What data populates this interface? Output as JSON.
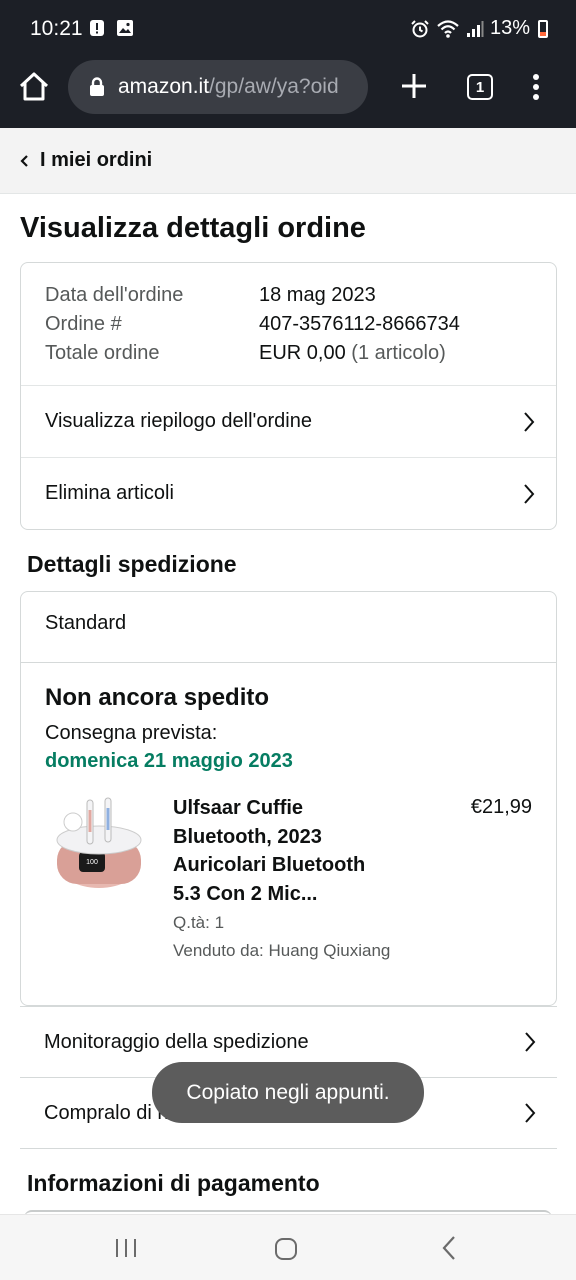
{
  "status_bar": {
    "time": "10:21",
    "battery": "13%"
  },
  "browser": {
    "url_host": "amazon.it",
    "url_path": "/gp/aw/ya?oid",
    "tab_count": "1"
  },
  "nav": {
    "back_label": "I miei ordini"
  },
  "page": {
    "title": "Visualizza dettagli ordine"
  },
  "summary": {
    "order_date_label": "Data dell'ordine",
    "order_date": "18 mag 2023",
    "order_number_label": "Ordine #",
    "order_number": "407-3576112-8666734",
    "order_total_label": "Totale ordine",
    "order_total": "EUR 0,00",
    "order_items": "(1 articolo)",
    "view_summary": "Visualizza riepilogo dell'ordine",
    "remove_items": "Elimina articoli"
  },
  "shipping": {
    "section_title": "Dettagli spedizione",
    "method": "Standard",
    "status": "Non ancora spedito",
    "eta_label": "Consegna prevista:",
    "eta_date": "domenica 21 maggio 2023",
    "product": {
      "title": "Ulfsaar Cuffie Bluetooth, 2023 Auricolari Bluetooth 5.3 Con 2 Mic...",
      "price": "€21,99",
      "qty": "Q.tà: 1",
      "seller": "Venduto da: Huang Qiuxiang",
      "image_icon": "earbuds-product-image"
    },
    "track_package": "Monitoraggio della spedizione",
    "buy_again": "Compralo di nuovo"
  },
  "payment": {
    "section_title": "Informazioni di pagamento"
  },
  "toast": {
    "message": "Copiato negli appunti."
  },
  "colors": {
    "chrome_bg": "#1c1f26",
    "eta_green": "#067d62",
    "text": "#0f1111",
    "muted": "#565959"
  }
}
